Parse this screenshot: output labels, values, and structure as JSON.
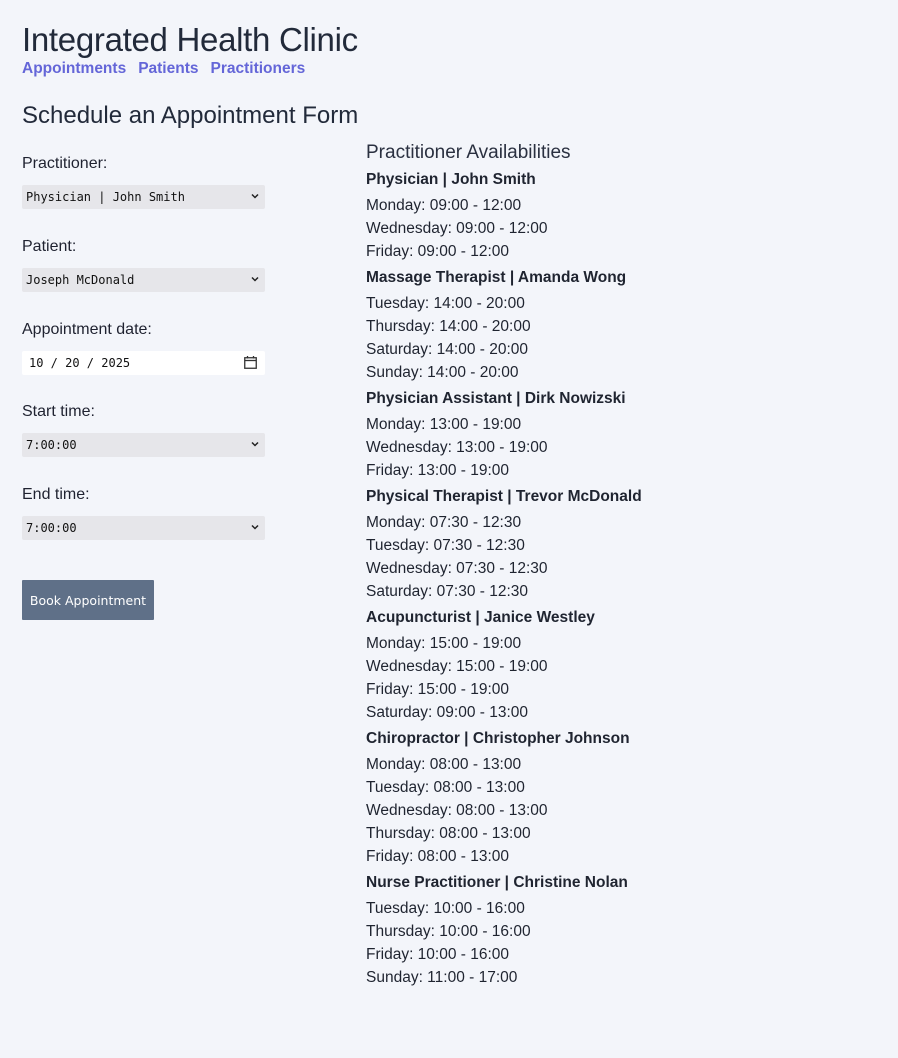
{
  "header": {
    "title": "Integrated Health Clinic",
    "nav": [
      "Appointments",
      "Patients",
      "Practitioners"
    ]
  },
  "form": {
    "title": "Schedule an Appointment Form",
    "practitioner_label": "Practitioner:",
    "practitioner_value": "Physician | John Smith",
    "patient_label": "Patient:",
    "patient_value": "Joseph McDonald",
    "date_label": "Appointment date:",
    "date_value": "10 / 20 / 2025",
    "start_label": "Start time:",
    "start_value": "7:00:00",
    "end_label": "End time:",
    "end_value": "7:00:00",
    "submit_label": "Book Appointment"
  },
  "availability": {
    "title": "Practitioner Availabilities",
    "practitioners": [
      {
        "name": "Physician | John Smith",
        "slots": [
          "Monday: 09:00 - 12:00",
          "Wednesday: 09:00 - 12:00",
          "Friday: 09:00 - 12:00"
        ]
      },
      {
        "name": "Massage Therapist | Amanda Wong",
        "slots": [
          "Tuesday: 14:00 - 20:00",
          "Thursday: 14:00 - 20:00",
          "Saturday: 14:00 - 20:00",
          "Sunday: 14:00 - 20:00"
        ]
      },
      {
        "name": "Physician Assistant | Dirk Nowizski",
        "slots": [
          "Monday: 13:00 - 19:00",
          "Wednesday: 13:00 - 19:00",
          "Friday: 13:00 - 19:00"
        ]
      },
      {
        "name": "Physical Therapist | Trevor McDonald",
        "slots": [
          "Monday: 07:30 - 12:30",
          "Tuesday: 07:30 - 12:30",
          "Wednesday: 07:30 - 12:30",
          "Saturday: 07:30 - 12:30"
        ]
      },
      {
        "name": "Acupuncturist | Janice Westley",
        "slots": [
          "Monday: 15:00 - 19:00",
          "Wednesday: 15:00 - 19:00",
          "Friday: 15:00 - 19:00",
          "Saturday: 09:00 - 13:00"
        ]
      },
      {
        "name": "Chiropractor | Christopher Johnson",
        "slots": [
          "Monday: 08:00 - 13:00",
          "Tuesday: 08:00 - 13:00",
          "Wednesday: 08:00 - 13:00",
          "Thursday: 08:00 - 13:00",
          "Friday: 08:00 - 13:00"
        ]
      },
      {
        "name": "Nurse Practitioner | Christine Nolan",
        "slots": [
          "Tuesday: 10:00 - 16:00",
          "Thursday: 10:00 - 16:00",
          "Friday: 10:00 - 16:00",
          "Sunday: 11:00 - 17:00"
        ]
      }
    ]
  },
  "colors": {
    "background": "#f3f5fa",
    "nav_link": "#6466d8",
    "button": "#5f7088"
  }
}
